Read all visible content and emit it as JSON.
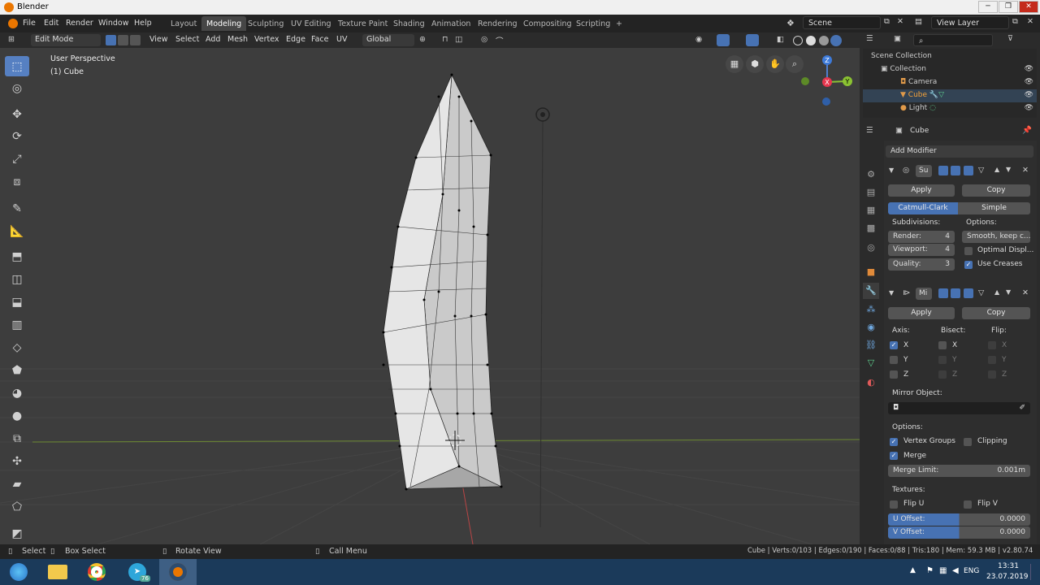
{
  "window": {
    "title": "Blender",
    "controls": [
      "─",
      "❐",
      "✕"
    ]
  },
  "menu": [
    "File",
    "Edit",
    "Render",
    "Window",
    "Help"
  ],
  "workspaces": [
    "Layout",
    "Modeling",
    "Sculpting",
    "UV Editing",
    "Texture Paint",
    "Shading",
    "Animation",
    "Rendering",
    "Compositing",
    "Scripting",
    "+"
  ],
  "active_workspace": "Modeling",
  "scene": {
    "label": "Scene",
    "view_layer": "View Layer"
  },
  "header": {
    "mode": "Edit Mode",
    "items": [
      "View",
      "Select",
      "Add",
      "Mesh",
      "Vertex",
      "Edge",
      "Face",
      "UV"
    ],
    "transform": "Global"
  },
  "viewport": {
    "perspective": "User Perspective",
    "object": "(1) Cube"
  },
  "gizmo": {
    "z": "Z",
    "y": "Y",
    "x": "X"
  },
  "outliner": {
    "root": "Scene Collection",
    "items": [
      {
        "label": "Collection",
        "icon": "collection-icon"
      },
      {
        "label": "Camera",
        "icon": "camera-icon"
      },
      {
        "label": "Cube",
        "icon": "mesh-icon"
      },
      {
        "label": "Light",
        "icon": "light-icon"
      }
    ]
  },
  "properties": {
    "object_name": "Cube",
    "add_modifier": "Add Modifier",
    "subsurf": {
      "name": "Su",
      "apply": "Apply",
      "copy": "Copy",
      "types": [
        "Catmull-Clark",
        "Simple"
      ],
      "subdivisions_label": "Subdivisions:",
      "options_label": "Options:",
      "render": {
        "label": "Render:",
        "value": "4"
      },
      "viewport": {
        "label": "Viewport:",
        "value": "4"
      },
      "quality": {
        "label": "Quality:",
        "value": "3"
      },
      "uv_smooth": "Smooth, keep c...",
      "optimal": "Optimal Displ...",
      "use_creases": "Use Creases"
    },
    "mirror": {
      "name": "Mi",
      "apply": "Apply",
      "copy": "Copy",
      "axis_label": "Axis:",
      "bisect_label": "Bisect:",
      "flip_label": "Flip:",
      "axes": [
        "X",
        "Y",
        "Z"
      ],
      "mirror_object": "Mirror Object:",
      "options": "Options:",
      "vertex_groups": "Vertex Groups",
      "clipping": "Clipping",
      "merge": "Merge",
      "merge_limit": {
        "label": "Merge Limit:",
        "value": "0.001m"
      },
      "textures": "Textures:",
      "flip_u": "Flip U",
      "flip_v": "Flip V",
      "u_offset": {
        "label": "U Offset:",
        "value": "0.0000"
      },
      "v_offset": {
        "label": "V Offset:",
        "value": "0.0000"
      }
    }
  },
  "status": {
    "select": "Select",
    "box_select": "Box Select",
    "rotate": "Rotate View",
    "call_menu": "Call Menu",
    "stats": "Cube | Verts:0/103 | Edges:0/190 | Faces:0/88 | Tris:180 | Mem: 59.3 MB | v2.80.74"
  },
  "taskbar": {
    "time": "13:31",
    "date": "23.07.2019",
    "lang": "ENG",
    "telegram_badge": "76"
  },
  "colors": {
    "accent": "#4772b3",
    "viewport_bg": "#3d3d3d",
    "orange": "#ea7600"
  }
}
